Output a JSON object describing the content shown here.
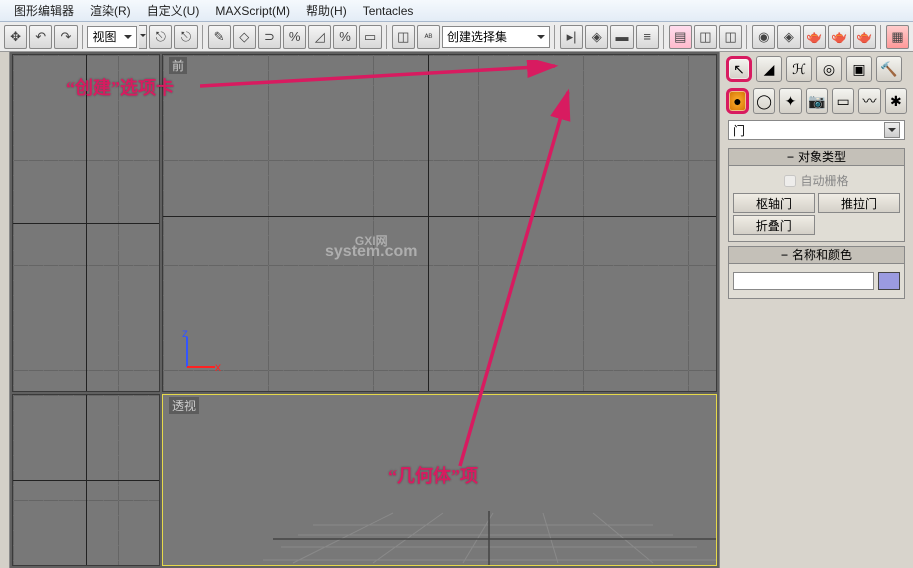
{
  "menu": {
    "items": [
      "图形编辑器",
      "渲染(R)",
      "自定义(U)",
      "MAXScript(M)",
      "帮助(H)",
      "Tentacles"
    ]
  },
  "toolbar": {
    "view_dropdown": "视图",
    "selset_dropdown": "创建选择集"
  },
  "viewports": {
    "top_right_label": "前",
    "bottom_right_label": "透视"
  },
  "cp": {
    "category_dropdown": "门",
    "rollout1_title": "对象类型",
    "autogrid_label": "自动栅格",
    "btn_pivot": "枢轴门",
    "btn_slide": "推拉门",
    "btn_fold": "折叠门",
    "rollout2_title": "名称和颜色"
  },
  "annotations": {
    "create_tab": "“创建”选项卡",
    "geometry": "“几何体”项"
  },
  "watermark": {
    "line1": "GXI网",
    "line2": "system.com"
  }
}
